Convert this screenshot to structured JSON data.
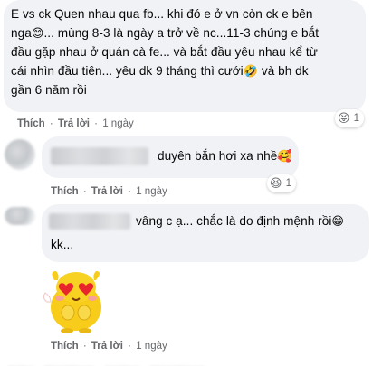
{
  "comments": [
    {
      "text_l1": "E vs ck Quen nhau qua fb... khi đó e ở vn còn ck e bên",
      "text_l2a": "nga",
      "text_l2_emoji": "😊",
      "text_l2b": "... mùng 8-3 là ngày a trở về nc...11-3 chúng e bắt",
      "text_l3": "đầu gặp nhau ở quán cà fe... và bắt đầu yêu nhau kể từ",
      "text_l4a": "cái nhìn đầu tiên... yêu dk 9 tháng thì cưới",
      "text_l4_emoji": "🤣",
      "text_l4b": " và bh dk",
      "text_l5": "gần 6 năm rồi",
      "like": "Thích",
      "reply": "Trả lời",
      "sep": "·",
      "time": "1 ngày",
      "reaction_emoji": "😝",
      "reaction_count": "1"
    },
    {
      "text": "duyên bắn hơi xa nhề",
      "text_emoji": "🥰",
      "like": "Thích",
      "reply": "Trả lời",
      "sep": "·",
      "time": "1 ngày",
      "reaction_emoji": "😆",
      "reaction_count": "1"
    },
    {
      "text_l1": "vâng c ạ... chắc là do định mệnh rồi",
      "text_l1_emoji": "😁",
      "text_l2": "kk..."
    },
    {
      "sticker": "heart-eyes-sticker",
      "like": "Thích",
      "reply": "Trả lời",
      "sep": "·",
      "time": "1 ngày"
    }
  ]
}
